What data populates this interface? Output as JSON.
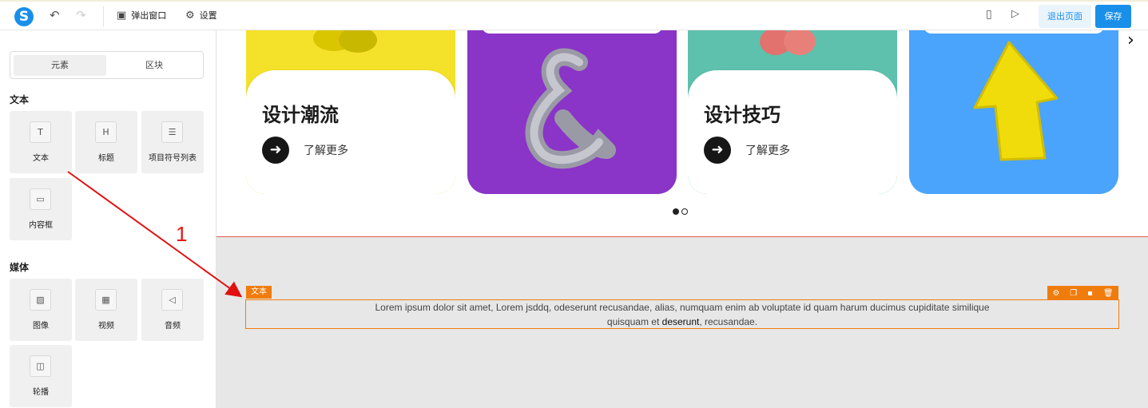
{
  "topbar": {
    "undo_icon": "undo-icon",
    "redo_icon": "redo-icon",
    "popup_label": "弹出窗口",
    "settings_label": "设置",
    "exit_label": "退出页面",
    "save_label": "保存"
  },
  "sidebar": {
    "tabs": [
      "元素",
      "区块"
    ],
    "text_section": "文本",
    "text_items": [
      "文本",
      "标题",
      "项目符号列表",
      "内容框"
    ],
    "media_section": "媒体",
    "media_items": [
      "图像",
      "视频",
      "音频",
      "轮播"
    ]
  },
  "cards": [
    {
      "title": "设计潮流",
      "more": "了解更多",
      "color": "#f4e12a"
    },
    {
      "title": "",
      "more": "",
      "color": "#8a34c8"
    },
    {
      "title": "设计技巧",
      "more": "了解更多",
      "color": "#5dc1ad"
    },
    {
      "title": "",
      "more": "",
      "color": "#4aa4fb"
    }
  ],
  "selected_block": {
    "tag": "文本",
    "text_before": "Lorem ipsum dolor sit amet, Lorem jsddq, odeserunt recusandae, alias, numquam enim ab voluptate id quam harum ducimus cupiditate similique quisquam et ",
    "text_bold": "deserunt",
    "text_after": ", recusandae."
  },
  "annotation": {
    "number": "1",
    "color": "#e11111"
  },
  "colors": {
    "accent": "#1a8fea",
    "selection": "#f07c0d"
  }
}
